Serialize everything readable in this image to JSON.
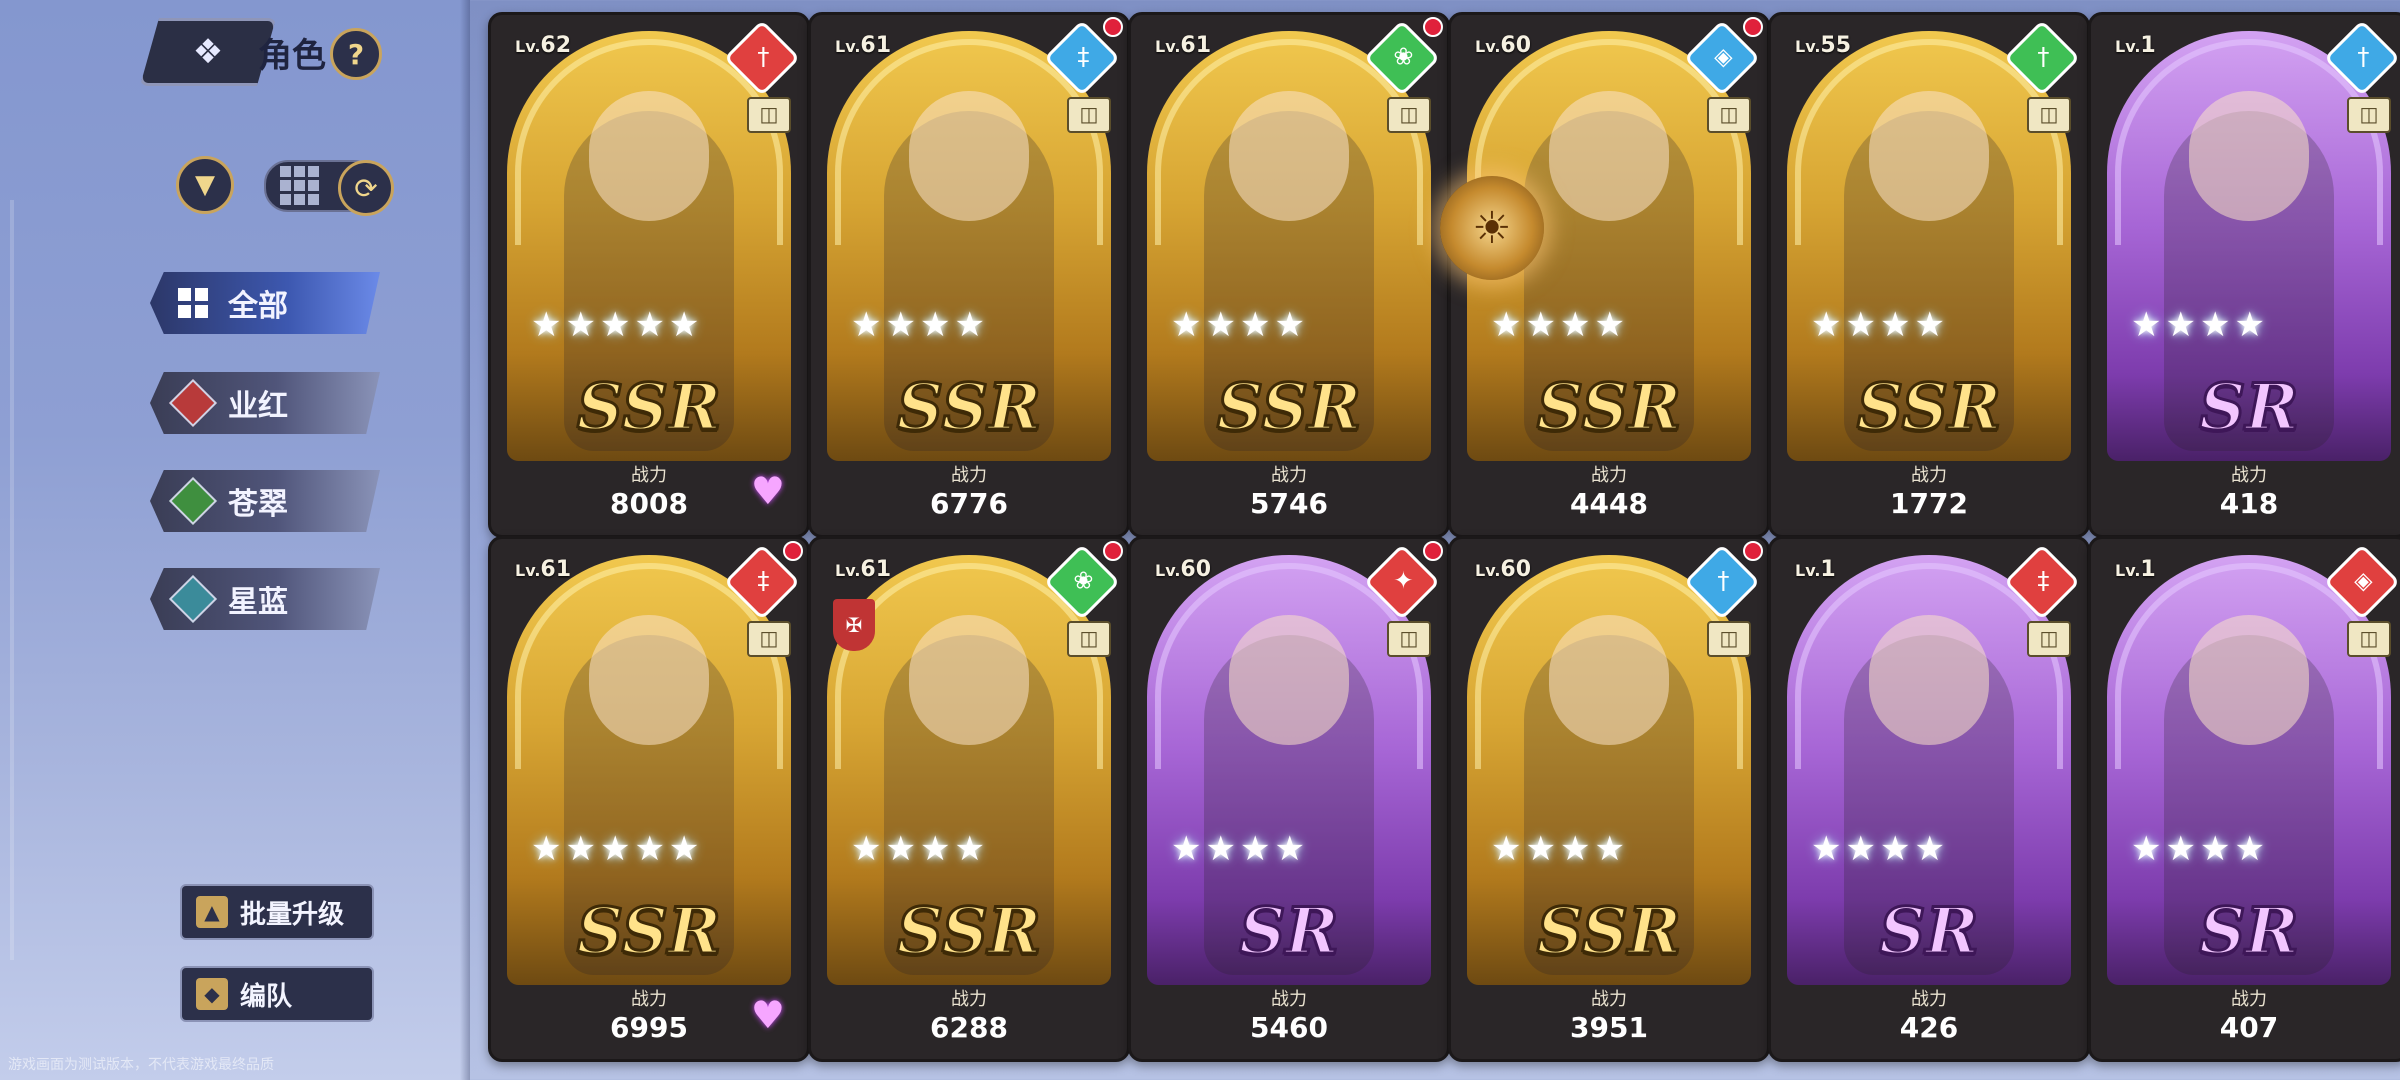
{
  "sidebar": {
    "back_icon": "diamond-arrow-back",
    "title": "角色",
    "help_label": "?",
    "filter_icon": "funnel-icon",
    "view_icon": "grid-icon",
    "refresh_icon": "refresh-icon",
    "categories": [
      {
        "label": "全部",
        "color": "#3d58b0"
      },
      {
        "label": "业红",
        "color": "#b83a3a"
      },
      {
        "label": "苍翠",
        "color": "#3f8f3f"
      },
      {
        "label": "星蓝",
        "color": "#3b8b9a"
      }
    ],
    "batch_upgrade_label": "批量升级",
    "team_label": "编队"
  },
  "footnote": "游戏画面为测试版本，不代表游戏最终品质",
  "power_label": "战力",
  "level_prefix": "Lv.",
  "cards": [
    {
      "level": "62",
      "rarity": "SSR",
      "element": "red",
      "element_icon": "sword-icon",
      "power": "8008",
      "stars": 5,
      "heart": true,
      "notif": false
    },
    {
      "level": "61",
      "rarity": "SSR",
      "element": "blue",
      "element_icon": "dagger-icon",
      "power": "6776",
      "stars": 4,
      "heart": false,
      "notif": true
    },
    {
      "level": "61",
      "rarity": "SSR",
      "element": "green",
      "element_icon": "flame-icon",
      "power": "5746",
      "stars": 4,
      "heart": false,
      "notif": true
    },
    {
      "level": "60",
      "rarity": "SSR",
      "element": "blue",
      "element_icon": "shield-icon",
      "power": "4448",
      "stars": 4,
      "heart": false,
      "notif": true
    },
    {
      "level": "55",
      "rarity": "SSR",
      "element": "green",
      "element_icon": "sword-icon",
      "power": "1772",
      "stars": 4,
      "heart": false,
      "notif": false
    },
    {
      "level": "1",
      "rarity": "SR",
      "element": "blue",
      "element_icon": "sword-icon",
      "power": "418",
      "stars": 4,
      "heart": false,
      "notif": false
    },
    {
      "level": "61",
      "rarity": "SSR",
      "element": "red",
      "element_icon": "dagger-icon",
      "power": "6995",
      "stars": 5,
      "heart": true,
      "notif": true
    },
    {
      "level": "61",
      "rarity": "SSR",
      "element": "green",
      "element_icon": "flame-icon",
      "power": "6288",
      "stars": 4,
      "heart": false,
      "notif": true,
      "emblem": true
    },
    {
      "level": "60",
      "rarity": "SR",
      "element": "red",
      "element_icon": "staff-icon",
      "power": "5460",
      "stars": 4,
      "heart": false,
      "notif": true
    },
    {
      "level": "60",
      "rarity": "SSR",
      "element": "blue",
      "element_icon": "sword-icon",
      "power": "3951",
      "stars": 4,
      "heart": false,
      "notif": true
    },
    {
      "level": "1",
      "rarity": "SR",
      "element": "red",
      "element_icon": "dagger-icon",
      "power": "426",
      "stars": 4,
      "heart": false,
      "notif": false
    },
    {
      "level": "1",
      "rarity": "SR",
      "element": "red",
      "element_icon": "shield-icon",
      "power": "407",
      "stars": 4,
      "heart": false,
      "notif": false
    }
  ],
  "colors": {
    "red": "#e0403f",
    "blue": "#3fa9e6",
    "green": "#3fbf55",
    "ssr": "#f1c84e",
    "sr": "#a766d6"
  }
}
